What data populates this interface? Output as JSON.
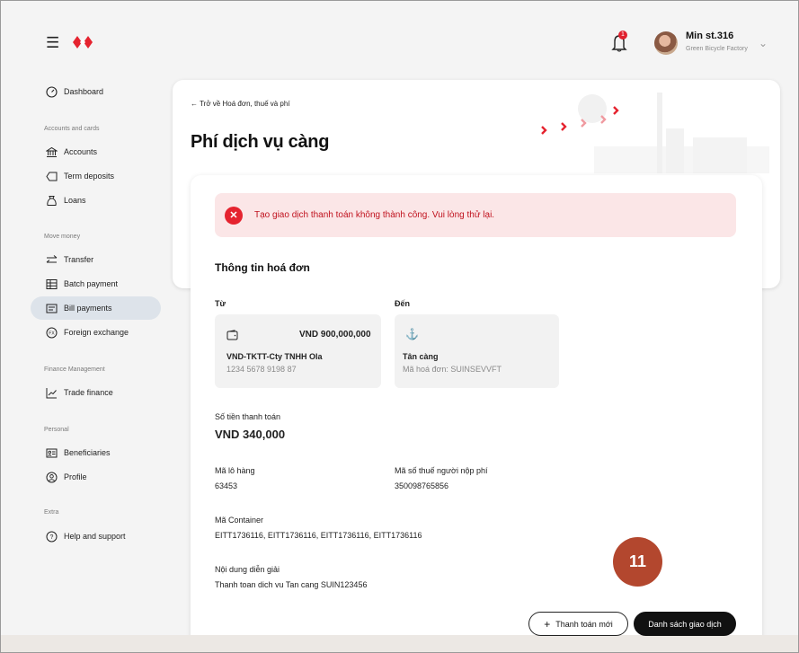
{
  "topbar": {
    "menu_icon": "hamburger-icon",
    "logo_icon": "bank-logo-icon",
    "notification_count": "1",
    "user_name": "Min st.316",
    "user_org": "Green Bicycle Factory"
  },
  "sidebar": {
    "dashboard": "Dashboard",
    "sections": {
      "accounts_and_cards": "Accounts and cards",
      "move_money": "Move money",
      "finance_management": "Finance Management",
      "personal": "Personal",
      "extra": "Extra"
    },
    "items": {
      "accounts": "Accounts",
      "term_deposits": "Term deposits",
      "loans": "Loans",
      "transfer": "Transfer",
      "batch_payment": "Batch payment",
      "bill_payments": "Bill payments",
      "foreign_exchange": "Foreign exchange",
      "trade_finance": "Trade finance",
      "beneficiaries": "Beneficiaries",
      "profile": "Profile",
      "help_and_support": "Help and support"
    },
    "active_item": "Bill payments"
  },
  "header": {
    "back_link": "Trở về Hoá đơn, thuế và phí",
    "title": "Phí dịch vụ càng"
  },
  "alert": {
    "message": "Tạo giao dịch thanh toán không thành công. Vui lòng thử lại.",
    "color": "#e5232f"
  },
  "invoice": {
    "section_title": "Thông tin hoá đơn",
    "from_label": "Từ",
    "to_label": "Đến",
    "from_account": {
      "balance": "VND 900,000,000",
      "name": "VND-TKTT-Cty TNHH Ola",
      "number": "1234 5678 9198 87"
    },
    "to_account": {
      "name": "Tân càng",
      "invoice_code": "Mã hoá đơn: SUINSEVVFT"
    },
    "amount_label": "Số tiền thanh toán",
    "amount_value": "VND 340,000",
    "lot_label": "Mã lô hàng",
    "lot_value": "63453",
    "tax_label": "Mã số thuế người nộp phí",
    "tax_value": "350098765856",
    "container_label": "Mã Container",
    "container_value": "EITT1736116, EITT1736116, EITT1736116, EITT1736116",
    "description_label": "Nội dung diễn giải",
    "description_value": "Thanh toan dich vu Tan cang SUIN123456"
  },
  "actions": {
    "new_payment": "Thanh toán mới",
    "transaction_list": "Danh sách giao dịch"
  },
  "step_badge": "11",
  "colors": {
    "brand_red": "#e5232f",
    "alert_bg": "#fbe6e7",
    "step_badge": "#b3472e",
    "active_nav": "#dde3ea"
  }
}
